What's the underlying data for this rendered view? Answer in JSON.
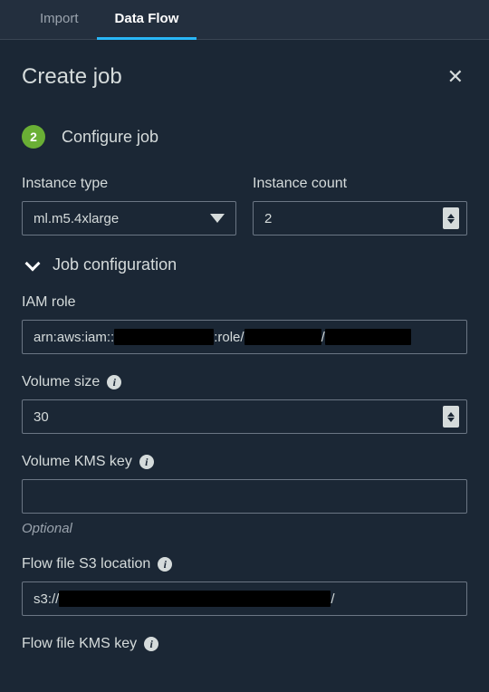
{
  "tabs": {
    "import": "Import",
    "data_flow": "Data Flow"
  },
  "panel": {
    "title": "Create job",
    "close_label": "✕"
  },
  "step": {
    "number": "2",
    "title": "Configure job"
  },
  "instance_type": {
    "label": "Instance type",
    "value": "ml.m5.4xlarge"
  },
  "instance_count": {
    "label": "Instance count",
    "value": "2"
  },
  "job_config_section": {
    "title": "Job configuration"
  },
  "iam_role": {
    "label": "IAM role",
    "prefix": "arn:aws:iam::",
    "mid": ":role/",
    "sep": "/"
  },
  "volume_size": {
    "label": "Volume size",
    "value": "30"
  },
  "volume_kms": {
    "label": "Volume KMS key",
    "value": "",
    "helper": "Optional"
  },
  "flow_s3": {
    "label": "Flow file S3 location",
    "prefix": "s3://",
    "sep": "/"
  },
  "flow_kms": {
    "label": "Flow file KMS key"
  },
  "icons": {
    "info": "i"
  }
}
